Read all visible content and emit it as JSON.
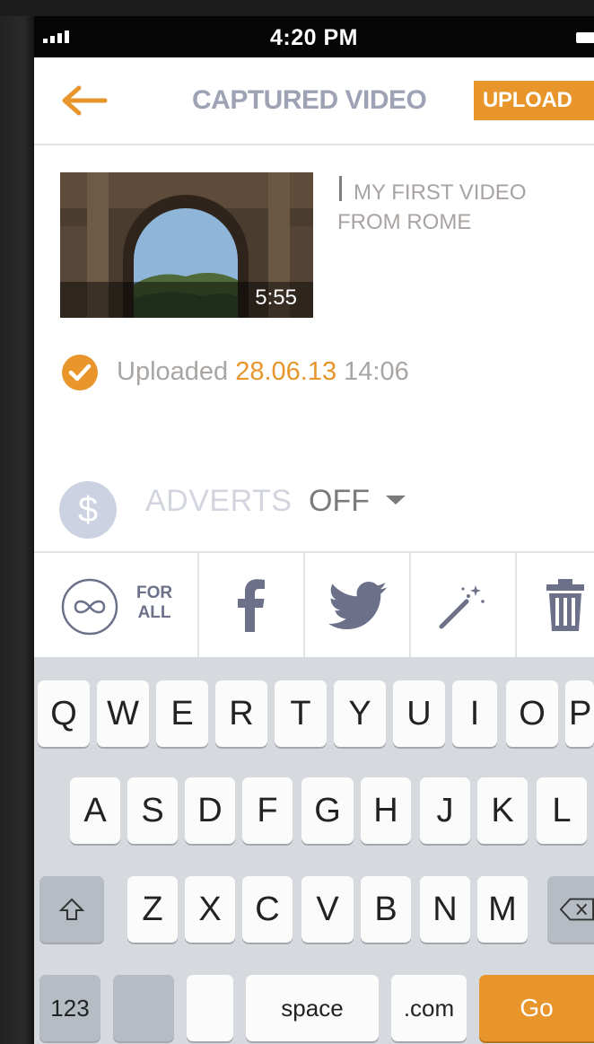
{
  "status_bar": {
    "time": "4:20 PM"
  },
  "header": {
    "title": "CAPTURED VIDEO",
    "upload_label": "UPLOAD"
  },
  "video": {
    "duration": "5:55",
    "caption": "MY FIRST VIDEO FROM ROME"
  },
  "upload_status": {
    "label": "Uploaded",
    "date": "28.06.13",
    "time": "14:06"
  },
  "adverts": {
    "icon_symbol": "$",
    "label": "ADVERTS",
    "value": "OFF"
  },
  "share": {
    "for_all_line1": "FOR",
    "for_all_line2": "ALL",
    "icons": [
      "for-all-icon",
      "facebook-icon",
      "twitter-icon",
      "magic-wand-icon",
      "trash-icon"
    ]
  },
  "keyboard": {
    "row1": [
      "Q",
      "W",
      "E",
      "R",
      "T",
      "Y",
      "U",
      "I",
      "O",
      "P"
    ],
    "row2": [
      "A",
      "S",
      "D",
      "F",
      "G",
      "H",
      "J",
      "K",
      "L"
    ],
    "row3": [
      "Z",
      "X",
      "C",
      "V",
      "B",
      "N",
      "M"
    ],
    "numbers_label": "123",
    "space_label": "space",
    "dotcom_label": ".com",
    "go_label": "Go"
  },
  "colors": {
    "accent": "#e8962b",
    "title": "#9da2b5",
    "icon": "#6c7189",
    "keyboard_bg": "#d6d9de"
  }
}
